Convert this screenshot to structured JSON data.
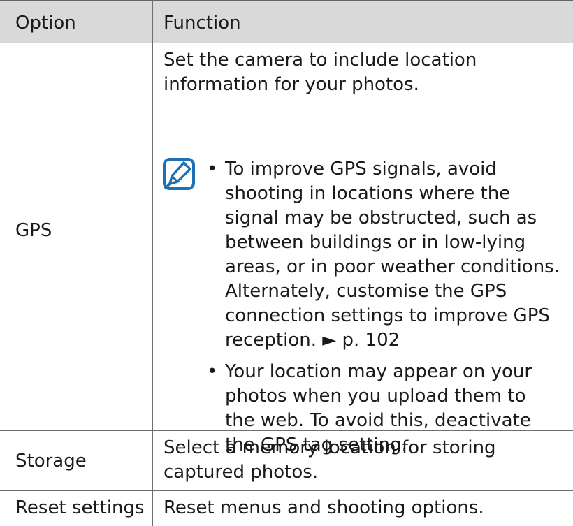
{
  "table": {
    "header": {
      "option": "Option",
      "function": "Function"
    },
    "rows": [
      {
        "option": "GPS",
        "description": "Set the camera to include location information for your photos.",
        "notes": [
          "To improve GPS signals, avoid shooting in locations where the signal may be obstructed, such as between buildings or in low-lying areas, or in poor weather conditions. Alternately, customise the GPS connection settings to improve GPS reception. ► p. 102",
          "Your location may appear on your photos when you upload them to the web. To avoid this, deactivate the GPS tag setting."
        ]
      },
      {
        "option": "Storage",
        "description": "Select a memory location for storing captured photos."
      },
      {
        "option": "Reset settings",
        "description": "Reset menus and shooting options."
      }
    ]
  },
  "icons": {
    "note": "note-pencil-icon"
  },
  "colors": {
    "header_bg": "#d9d9d9",
    "icon_blue": "#1f6fb7",
    "rule": "#6e6e6e"
  }
}
